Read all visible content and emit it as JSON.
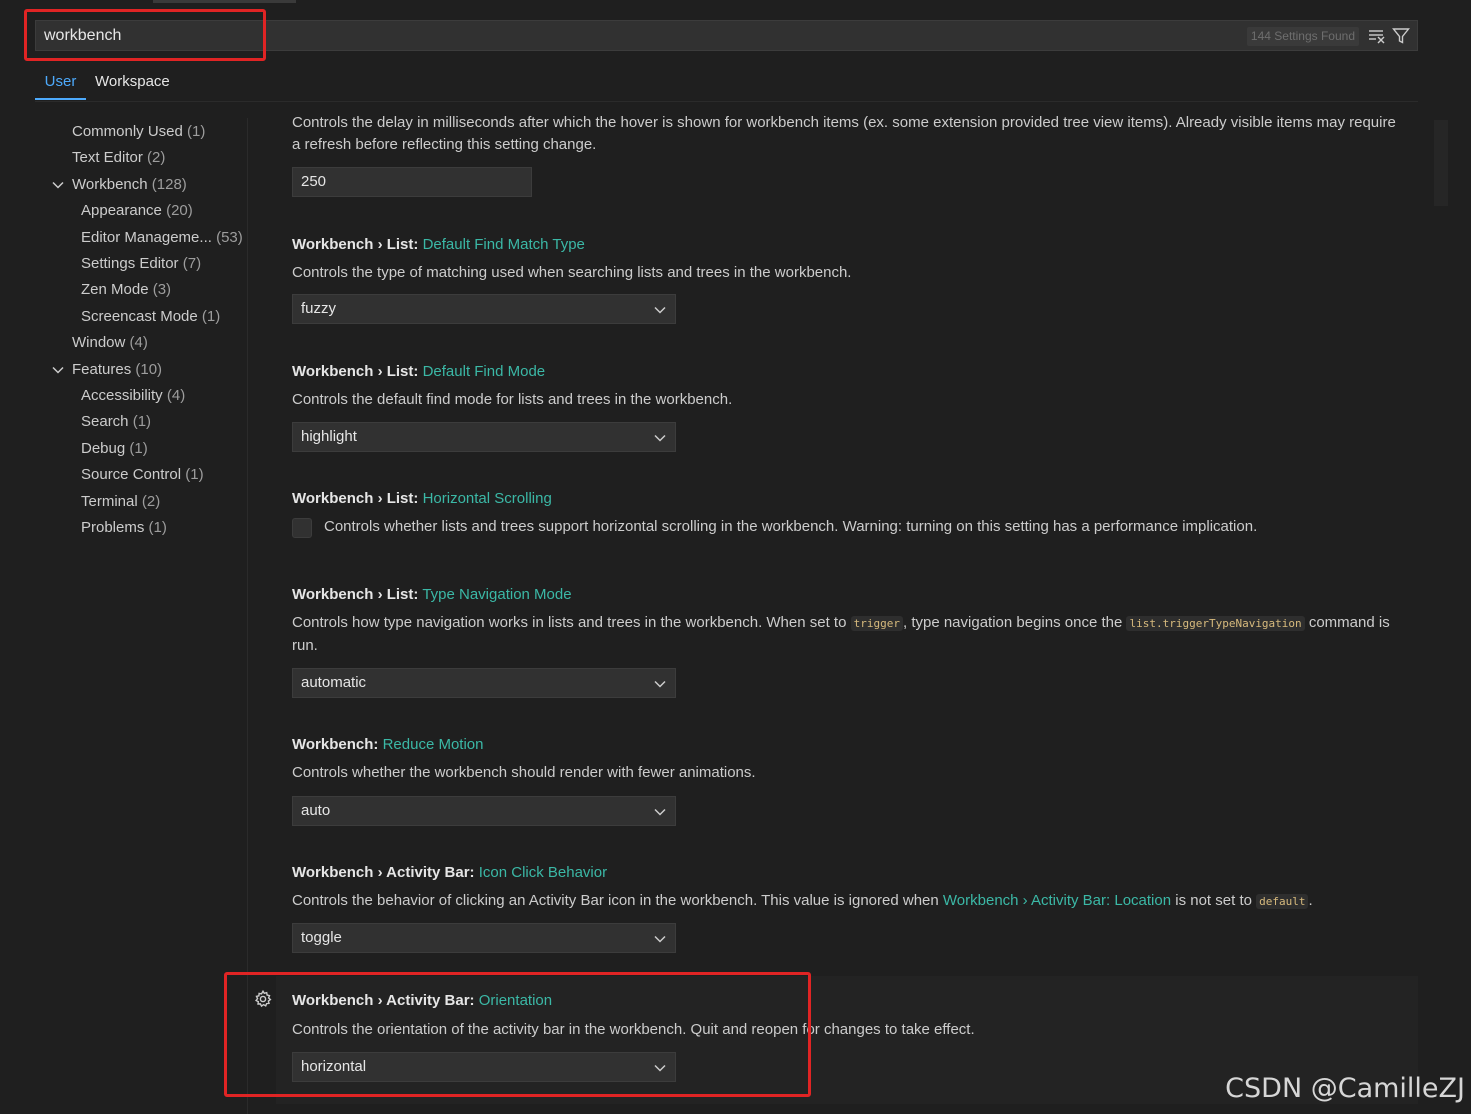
{
  "search": {
    "value": "workbench",
    "results_count": "144 Settings Found"
  },
  "icons": {
    "clear_filters": "clear-filter-icon",
    "filter": "filter-icon",
    "gear": "gear-icon",
    "chevron": "chevron-down-icon"
  },
  "scope_tabs": [
    "User",
    "Workspace"
  ],
  "toc": [
    {
      "label": "Commonly Used",
      "count": "(1)"
    },
    {
      "label": "Text Editor",
      "count": "(2)"
    },
    {
      "label": "Workbench",
      "count": "(128)"
    },
    {
      "label": "Appearance",
      "count": "(20)"
    },
    {
      "label": "Editor Manageme...",
      "count": "(53)"
    },
    {
      "label": "Settings Editor",
      "count": "(7)"
    },
    {
      "label": "Zen Mode",
      "count": "(3)"
    },
    {
      "label": "Screencast Mode",
      "count": "(1)"
    },
    {
      "label": "Window",
      "count": "(4)"
    },
    {
      "label": "Features",
      "count": "(10)"
    },
    {
      "label": "Accessibility",
      "count": "(4)"
    },
    {
      "label": "Search",
      "count": "(1)"
    },
    {
      "label": "Debug",
      "count": "(1)"
    },
    {
      "label": "Source Control",
      "count": "(1)"
    },
    {
      "label": "Terminal",
      "count": "(2)"
    },
    {
      "label": "Problems",
      "count": "(1)"
    }
  ],
  "settings": {
    "hover_delay": {
      "desc": "Controls the delay in milliseconds after which the hover is shown for workbench items (ex. some extension provided tree view items). Already visible items may require a refresh before reflecting this setting change.",
      "value": "250"
    },
    "find_match_type": {
      "category": "Workbench › List:",
      "key": "Default Find Match Type",
      "desc": "Controls the type of matching used when searching lists and trees in the workbench.",
      "value": "fuzzy"
    },
    "find_mode": {
      "category": "Workbench › List:",
      "key": "Default Find Mode",
      "desc": "Controls the default find mode for lists and trees in the workbench.",
      "value": "highlight"
    },
    "horizontal_scrolling": {
      "category": "Workbench › List:",
      "key": "Horizontal Scrolling",
      "desc": "Controls whether lists and trees support horizontal scrolling in the workbench. Warning: turning on this setting has a performance implication."
    },
    "type_navigation": {
      "category": "Workbench › List:",
      "key": "Type Navigation Mode",
      "desc_1": "Controls how type navigation works in lists and trees in the workbench. When set to ",
      "code_1": "trigger",
      "desc_2": ", type navigation begins once the ",
      "code_2": "list.triggerTypeNavigation",
      "desc_3": " command is run.",
      "value": "automatic"
    },
    "reduce_motion": {
      "category": "Workbench:",
      "key": "Reduce Motion",
      "desc": "Controls whether the workbench should render with fewer animations.",
      "value": "auto"
    },
    "icon_click": {
      "category": "Workbench › Activity Bar:",
      "key": "Icon Click Behavior",
      "desc_1": "Controls the behavior of clicking an Activity Bar icon in the workbench. This value is ignored when ",
      "link": "Workbench › Activity Bar: Location",
      "desc_2": " is not set to ",
      "code": "default",
      "desc_3": ".",
      "value": "toggle"
    },
    "orientation": {
      "category": "Workbench › Activity Bar:",
      "key": "Orientation",
      "desc": "Controls the orientation of the activity bar in the workbench. Quit and reopen for changes to take effect.",
      "value": "horizontal"
    }
  },
  "watermark": "CSDN @CamilleZJ",
  "colors": {
    "accent": "#4daafc",
    "highlight_box": "#e02424",
    "setting_key": "#3bb8a6"
  }
}
